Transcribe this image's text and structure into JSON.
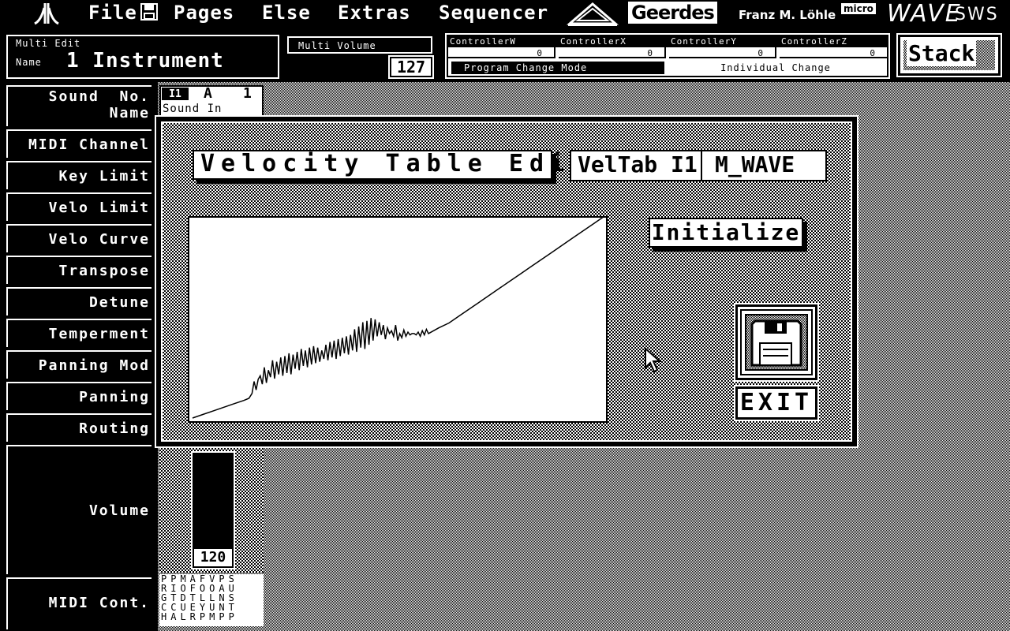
{
  "menubar": {
    "atari_logo": "atari-logo",
    "items": [
      {
        "label": "File"
      },
      {
        "label": "Pages"
      },
      {
        "label": "Else"
      },
      {
        "label": "Extras"
      },
      {
        "label": "Sequencer"
      }
    ],
    "brand_geerdes": "Geerdes",
    "brand_author": "Franz M. Löhle",
    "brand_micro": "micro",
    "brand_wave": "WAVE",
    "brand_sws": "SWS"
  },
  "multi_edit": {
    "title": "Multi Edit",
    "name_label": "Name",
    "name_value": "1 Instrument"
  },
  "multi_volume": {
    "title": "Multi Volume",
    "value": "127"
  },
  "controllers": {
    "headers": [
      "ControllerW",
      "ControllerX",
      "ControllerY",
      "ControllerZ"
    ],
    "values": [
      "0",
      "0",
      "0",
      "0"
    ],
    "mode_left": "Program Change Mode",
    "mode_right": "Individual Change"
  },
  "stack_button": "Stack",
  "sidebar": {
    "items": [
      {
        "label": "Sound  No."
      },
      {
        "label": "Name"
      },
      {
        "label": "MIDI Channel"
      },
      {
        "label": "Key Limit"
      },
      {
        "label": "Velo Limit"
      },
      {
        "label": "Velo Curve"
      },
      {
        "label": "Transpose"
      },
      {
        "label": "Detune"
      },
      {
        "label": "Temperment"
      },
      {
        "label": "Panning Mod"
      },
      {
        "label": "Panning"
      },
      {
        "label": "Routing"
      },
      {
        "label": "Volume"
      },
      {
        "label": "MIDI Cont."
      }
    ]
  },
  "instrument_tab": {
    "id": "I1",
    "bank": "A",
    "num": "1",
    "sound_partial": "Sound In"
  },
  "volume_slider": {
    "value": "120"
  },
  "midi_cont_letters": [
    "PPMAFVPS",
    "RIOFOOAU",
    "GTDTLLNS",
    "CCUEYUNT",
    "HALRPMPP"
  ],
  "dialog": {
    "title": "Velocity Table Edit",
    "veltab_label": "VelTab I1",
    "veltab_name": "M_WAVE",
    "initialize_button": "Initialize",
    "disk_icon": "floppy-disk-icon",
    "exit_button": "EXIT"
  },
  "chart_data": {
    "type": "line",
    "x": [
      0,
      10,
      20,
      30,
      40,
      50,
      55,
      58,
      60,
      62,
      64,
      66,
      68,
      70,
      72,
      74,
      76,
      78,
      80,
      82,
      84,
      86,
      88,
      90,
      92,
      94,
      96,
      98,
      100,
      102,
      104,
      106,
      108,
      110,
      112,
      114,
      116,
      118,
      120,
      122,
      124,
      126,
      128,
      130,
      132,
      134,
      136,
      138,
      140,
      142,
      144,
      146,
      148,
      150,
      152,
      154,
      156,
      158,
      160,
      162,
      164,
      166,
      168,
      170,
      172,
      174,
      176,
      178,
      180,
      182,
      184,
      186,
      188,
      190,
      192,
      194,
      196,
      198,
      200,
      202,
      204,
      206,
      208,
      210,
      212,
      214,
      216,
      218,
      220,
      222,
      224,
      226,
      228,
      230,
      240,
      250,
      260,
      270,
      280,
      290,
      300,
      310,
      320,
      330,
      340,
      350,
      360,
      370,
      380,
      390,
      400
    ],
    "y": [
      0,
      5,
      10,
      15,
      20,
      25,
      28,
      35,
      52,
      40,
      55,
      60,
      48,
      72,
      50,
      68,
      58,
      82,
      56,
      80,
      62,
      86,
      60,
      88,
      64,
      92,
      62,
      90,
      70,
      94,
      68,
      98,
      74,
      96,
      72,
      100,
      76,
      102,
      78,
      100,
      80,
      96,
      84,
      104,
      82,
      108,
      86,
      110,
      84,
      112,
      88,
      114,
      92,
      116,
      90,
      118,
      96,
      126,
      94,
      130,
      100,
      136,
      98,
      138,
      104,
      142,
      110,
      140,
      116,
      136,
      118,
      132,
      112,
      128,
      120,
      124,
      116,
      132,
      110,
      120,
      114,
      125,
      116,
      122,
      118,
      120,
      120,
      118,
      122,
      116,
      124,
      118,
      126,
      120,
      128,
      135,
      145,
      155,
      165,
      175,
      185,
      195,
      205,
      215,
      225,
      235,
      245,
      255,
      265,
      275,
      285
    ],
    "xlim": [
      0,
      400
    ],
    "ylim": [
      0,
      280
    ]
  }
}
